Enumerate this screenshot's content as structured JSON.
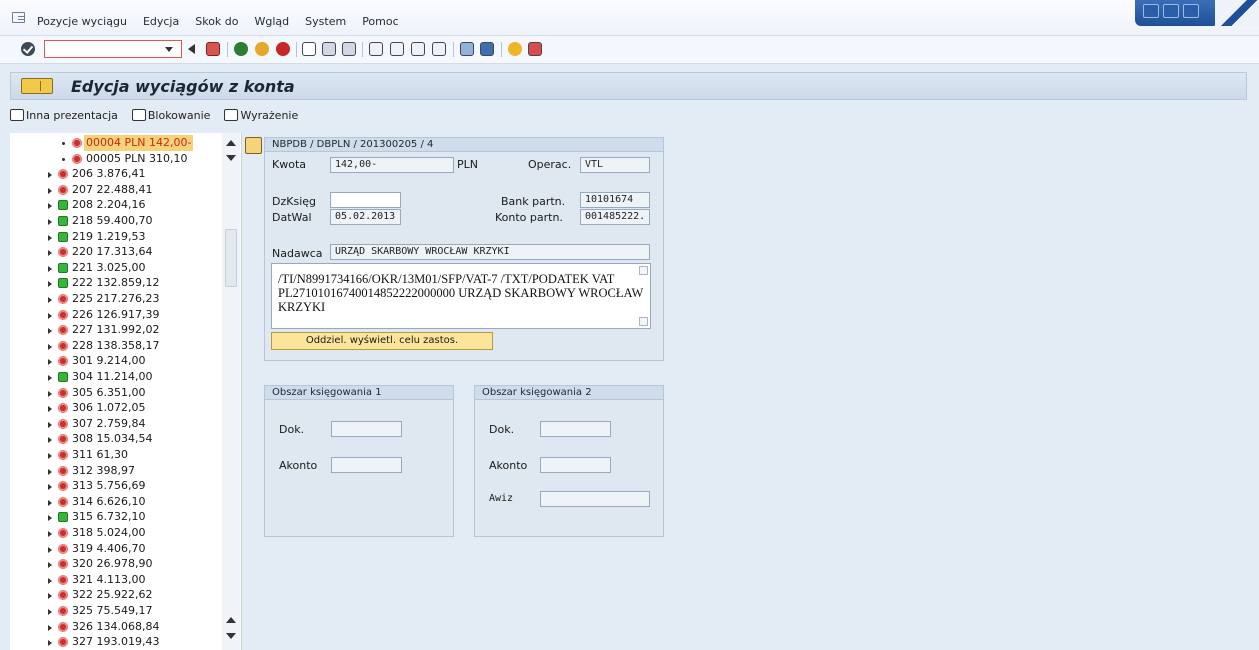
{
  "menu": {
    "items": [
      "Pozycje wyciągu",
      "Edycja",
      "Skok do",
      "Wgląd",
      "System",
      "Pomoc"
    ]
  },
  "toolbar": {
    "command_value": ""
  },
  "title": "Edycja wyciągów z konta",
  "app_toolbar": {
    "inna_prezentacja": "Inna prezentacja",
    "blokowanie": "Blokowanie",
    "wyrazenie": "Wyrażenie"
  },
  "tree": {
    "items": [
      {
        "label": "00004  PLN 142,00-",
        "status": "red",
        "level": 2,
        "selected": true
      },
      {
        "label": "00005  PLN 310,10",
        "status": "red",
        "level": 2,
        "selected": false
      },
      {
        "label": "206  3.876,41",
        "status": "red",
        "level": 1
      },
      {
        "label": "207  22.488,41",
        "status": "red",
        "level": 1
      },
      {
        "label": "208  2.204,16",
        "status": "green",
        "level": 1
      },
      {
        "label": "218  59.400,70",
        "status": "green",
        "level": 1
      },
      {
        "label": "219  1.219,53",
        "status": "green",
        "level": 1
      },
      {
        "label": "220  17.313,64",
        "status": "red",
        "level": 1
      },
      {
        "label": "221  3.025,00",
        "status": "green",
        "level": 1
      },
      {
        "label": "222  132.859,12",
        "status": "green",
        "level": 1
      },
      {
        "label": "225  217.276,23",
        "status": "red",
        "level": 1
      },
      {
        "label": "226  126.917,39",
        "status": "red",
        "level": 1
      },
      {
        "label": "227  131.992,02",
        "status": "red",
        "level": 1
      },
      {
        "label": "228  138.358,17",
        "status": "red",
        "level": 1
      },
      {
        "label": "301  9.214,00",
        "status": "red",
        "level": 1
      },
      {
        "label": "304  11.214,00",
        "status": "green",
        "level": 1
      },
      {
        "label": "305  6.351,00",
        "status": "red",
        "level": 1
      },
      {
        "label": "306  1.072,05",
        "status": "red",
        "level": 1
      },
      {
        "label": "307  2.759,84",
        "status": "red",
        "level": 1
      },
      {
        "label": "308  15.034,54",
        "status": "red",
        "level": 1
      },
      {
        "label": "311  61,30",
        "status": "red",
        "level": 1
      },
      {
        "label": "312  398,97",
        "status": "red",
        "level": 1
      },
      {
        "label": "313  5.756,69",
        "status": "red",
        "level": 1
      },
      {
        "label": "314  6.626,10",
        "status": "red",
        "level": 1
      },
      {
        "label": "315  6.732,10",
        "status": "green",
        "level": 1
      },
      {
        "label": "318  5.024,00",
        "status": "red",
        "level": 1
      },
      {
        "label": "319  4.406,70",
        "status": "red",
        "level": 1
      },
      {
        "label": "320  26.978,90",
        "status": "red",
        "level": 1
      },
      {
        "label": "321  4.113,00",
        "status": "red",
        "level": 1
      },
      {
        "label": "322  25.922,62",
        "status": "red",
        "level": 1
      },
      {
        "label": "325  75.549,17",
        "status": "red",
        "level": 1
      },
      {
        "label": "326  134.068,84",
        "status": "red",
        "level": 1
      },
      {
        "label": "327  193.019,43",
        "status": "red",
        "level": 1
      }
    ]
  },
  "detail": {
    "header": "NBPDB / DBPLN / 201300205 / 4",
    "kwota_label": "Kwota",
    "kwota_value": "142,00-",
    "currency": "PLN",
    "operac_label": "Operac.",
    "operac_value": "VTL",
    "dzksieg_label": "DzKsięg",
    "dzksieg_value": "",
    "bank_partn_label": "Bank partn.",
    "bank_partn_value": "10101674",
    "datwal_label": "DatWal",
    "datwal_value": "05.02.2013",
    "konto_partn_label": "Konto partn.",
    "konto_partn_value": "001485222.",
    "nadawca_label": "Nadawca",
    "nadawca_value": "URZĄD SKARBOWY WROCŁAW KRZYKI",
    "memo_text": "/TI/N8991734166/OKR/13M01/SFP/VAT-7 /TXT/PODATEK VAT PL27101016740014852222000000 URZĄD SKARBOWY WROCŁAW KRZYKI",
    "button_label": "Oddziel. wyświetl. celu zastos."
  },
  "obszar1": {
    "title": "Obszar księgowania 1",
    "dok_label": "Dok.",
    "dok_value": "",
    "akonto_label": "Akonto",
    "akonto_value": ""
  },
  "obszar2": {
    "title": "Obszar księgowania 2",
    "dok_label": "Dok.",
    "dok_value": "",
    "akonto_label": "Akonto",
    "akonto_value": "",
    "awiz_label": "Awiz",
    "awiz_value": ""
  },
  "colors": {
    "accent": "#1e4f97",
    "selected_bg": "#f6d27a",
    "red_status": "#c9302c",
    "green_status": "#35b53a"
  }
}
